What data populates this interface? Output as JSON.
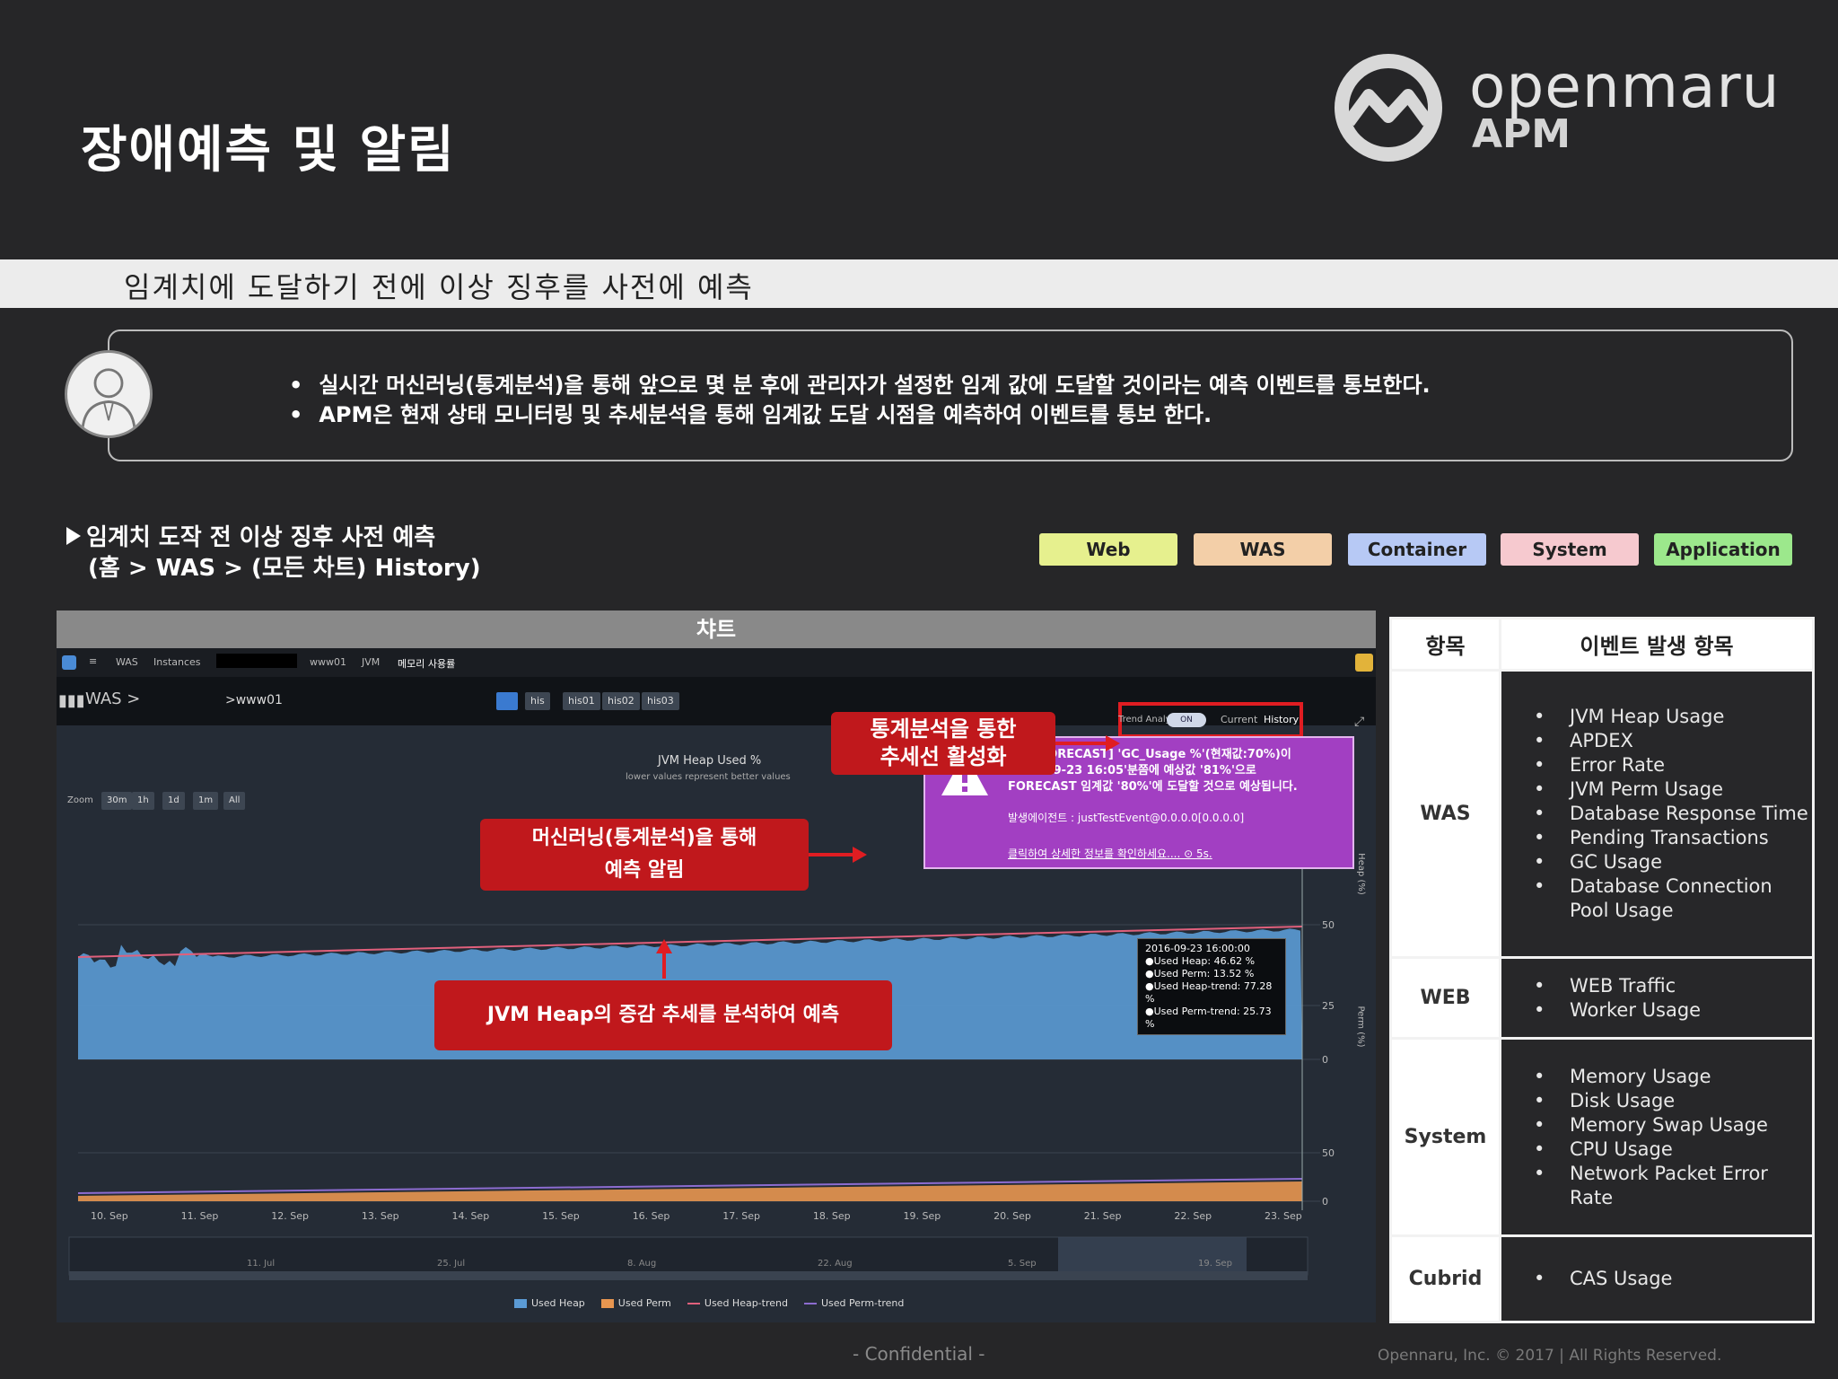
{
  "slide": {
    "title": "장애예측 및 알림",
    "subtitle": "임계치에 도달하기 전에 이상 징후를 사전에 예측",
    "bullets": [
      "실시간 머신러닝(통계분석)을 통해 앞으로 몇  분 후에 관리자가 설정한 임계 값에 도달할 것이라는 예측 이벤트를 통보한다.",
      "APM은 현재 상태 모니터링 및 추세분석을 통해 임계값 도달 시점을 예측하여 이벤트를 통보 한다."
    ],
    "section_label_1": "임계치 도작 전 이상 징후 사전 예측",
    "section_label_2": "(홈 > WAS > (모든 차트) History)",
    "footer_center": "- Confidential -",
    "footer_right": "Opennaru, Inc. ©  2017 | All Rights Reserved."
  },
  "logo": {
    "name": "openmaru",
    "sub": "APM",
    "icon": "openmaru-logo-icon"
  },
  "categories": [
    {
      "label": "Web",
      "color": "#e6f08e"
    },
    {
      "label": "WAS",
      "color": "#f3cfa8"
    },
    {
      "label": "Container",
      "color": "#b7c9f5"
    },
    {
      "label": "System",
      "color": "#f6c9cf"
    },
    {
      "label": "Application",
      "color": "#9ce88c"
    }
  ],
  "chart_panel": {
    "header": "챠트",
    "breadcrumb": [
      "WAS",
      "Instances",
      "www01",
      "JVM",
      "메모리 사용률"
    ],
    "was_label": "WAS >",
    "server": ">www01",
    "tabs": [
      "his",
      "his01",
      "his02",
      "his03"
    ],
    "trend_label": "Trend Analysis",
    "toggle": "ON",
    "current_btn": "Current",
    "history_btn": "History",
    "zoom_label": "Zoom",
    "zoom_options": [
      "30m",
      "1h",
      "1d",
      "1m",
      "All"
    ],
    "chart_title": "JVM Heap Used %",
    "chart_subtitle": "lower values represent better values",
    "y_heap_label": "Heap (%)",
    "y_perm_label": "Perm (%)",
    "y_ticks_top": [
      "50",
      "25",
      "0"
    ],
    "y_ticks_bottom": [
      "50",
      "0"
    ],
    "x_dates": [
      "10. Sep",
      "11. Sep",
      "12. Sep",
      "13. Sep",
      "14. Sep",
      "15. Sep",
      "16. Sep",
      "17. Sep",
      "18. Sep",
      "19. Sep",
      "20. Sep",
      "21. Sep",
      "22. Sep",
      "23. Sep"
    ],
    "navigator_dates": [
      "11. Jul",
      "25. Jul",
      "8. Aug",
      "22. Aug",
      "5. Sep",
      "19. Sep"
    ],
    "legend": [
      {
        "name": "Used Heap",
        "color": "#5b9bd5"
      },
      {
        "name": "Used Perm",
        "color": "#e89650"
      },
      {
        "name": "Used Heap-trend",
        "color": "#e0607c"
      },
      {
        "name": "Used Perm-trend",
        "color": "#8c6cd0"
      }
    ],
    "tooltip": {
      "time": "2016-09-23 16:00:00",
      "lines": [
        "●Used Heap: 46.62 %",
        "●Used Perm: 13.52 %",
        "●Used Heap-trend: 77.28 %",
        "●Used Perm-trend: 25.73 %"
      ]
    },
    "forecast": {
      "line1": "[예측-FORECAST] 'GC_Usage %'(현재값:70%)이",
      "line2": "2016-09-23 16:05'분쯤에 예상값 '81%'으로",
      "line3": "FORECAST 임계값 '80%'에 도달할 것으로 예상됩니다.",
      "agent": "발생에이전트 : justTestEvent@0.0.0.0[0.0.0.0]",
      "link": "클릭하여 상세한 정보를 확인하세요.... ⊙ 5s."
    }
  },
  "callouts": {
    "trend_1": "통계분석을 통한",
    "trend_2": "추세선 활성화",
    "ml_1": "머신러닝(통계분석)을 통해",
    "ml_2": "예측 알림",
    "heap": "JVM Heap의 증감 추세를 분석하여 예측"
  },
  "table": {
    "headers": [
      "항목",
      "이벤트 발생 항목"
    ],
    "rows": [
      {
        "category": "WAS",
        "items": [
          "JVM Heap Usage",
          "APDEX",
          "Error Rate",
          "JVM Perm Usage",
          "Database Response Time",
          "Pending Transactions",
          "GC Usage",
          "Database Connection Pool Usage"
        ]
      },
      {
        "category": "WEB",
        "items": [
          "WEB Traffic",
          "Worker Usage"
        ]
      },
      {
        "category": "System",
        "items": [
          "Memory Usage",
          "Disk Usage",
          "Memory Swap Usage",
          "CPU Usage",
          "Network Packet Error Rate"
        ]
      },
      {
        "category": "Cubrid",
        "items": [
          "CAS Usage"
        ]
      }
    ]
  }
}
